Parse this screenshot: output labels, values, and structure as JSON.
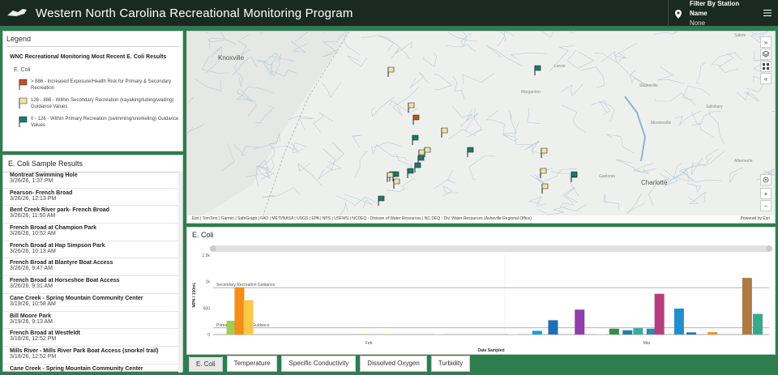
{
  "header": {
    "title": "Western North Carolina Recreational Monitoring Program",
    "filter_title": "Filter By Station Name",
    "filter_value": "None"
  },
  "legend": {
    "heading": "Legend",
    "title": "WNC Recreational Monitoring Most Recent E. Coli Results",
    "layer": "E. Coli",
    "items": [
      {
        "label": "> 886 - Increased Exposure/Health Risk for Primary & Secondary Recreation",
        "color": "#c0521f"
      },
      {
        "label": "126 - 886 - Within Secondary Recreation (kayaking/tubing/wading) Guidance Values",
        "color": "#ece3a6"
      },
      {
        "label": "0 - 126 - Within Primary Recreation (swimming/snorkeling) Guidance Values",
        "color": "#1d7a6a"
      }
    ]
  },
  "list": {
    "heading": "E. Coli Sample Results",
    "items": [
      {
        "name": "Montreat Swimming Hole",
        "date": "3/26/26, 1:37 PM"
      },
      {
        "name": "Pearson- French Broad",
        "date": "3/26/26, 12:13 PM"
      },
      {
        "name": "Bent Creek River park- French Broad",
        "date": "3/26/26, 11:50 AM"
      },
      {
        "name": "French Broad at Champion Park",
        "date": "3/26/26, 10:52 AM"
      },
      {
        "name": "French Broad at Hap Simpson Park",
        "date": "3/26/26, 10:13 AM"
      },
      {
        "name": "French Broad at Blantyre Boat Access",
        "date": "3/26/26, 9:47 AM"
      },
      {
        "name": "French Broad at Horseshoe Boat Access",
        "date": "3/26/26, 9:31 AM"
      },
      {
        "name": "Cane Creek - Spring Mountain Community Center",
        "date": "3/19/26, 10:58 AM"
      },
      {
        "name": "Bill Moore Park",
        "date": "3/19/26, 9:13 AM"
      },
      {
        "name": "French Broad at Westfeldt",
        "date": "3/18/26, 12:52 PM"
      },
      {
        "name": "Mills River - Mills River Park Boat Access (snorkel trail)",
        "date": "3/18/26, 12:52 PM"
      },
      {
        "name": "Cane Creek - Spring Mountain Community Center",
        "date": ""
      }
    ]
  },
  "map": {
    "cities": [
      "Knoxville",
      "Charlotte"
    ],
    "minor": [
      "Morganton",
      "Statesville",
      "Salisbury",
      "Mooresville",
      "Lenoir",
      "Gastonia",
      "Albemarle",
      "Salem"
    ],
    "attribution": "Esri | TomTom | Garmin | SafeGraph | FAO | METI/NASA | USGS | EPA | NPS | USFWS | NCDEQ - Division of Water Resources | NC DEQ - Div. Water Resources (Asheville Regional Office)",
    "powered": "Powered by Esri",
    "tools": {
      "expand": "»",
      "collapse": "«",
      "zoom_in": "+",
      "zoom_out": "−"
    }
  },
  "chart_title": "E. Coli",
  "chart_data": {
    "type": "bar",
    "ylabel": "MPN / 100mL",
    "xlabel": "Date Sampled",
    "yticks": [
      "0",
      "500",
      "1k",
      "1.5k"
    ],
    "ylim": [
      0,
      1500
    ],
    "xticks": [
      "Feb",
      "Mar"
    ],
    "reference_lines": [
      {
        "label": "Secondary Recreation Guidance",
        "value": 886
      },
      {
        "label": "Primary Recreation Guidance",
        "value": 126
      }
    ],
    "bars": [
      {
        "pos": 0.01,
        "value": 260,
        "color": "#a7c957"
      },
      {
        "pos": 0.025,
        "value": 890,
        "color": "#f28e1c"
      },
      {
        "pos": 0.042,
        "value": 650,
        "color": "#f7c948"
      },
      {
        "pos": 0.255,
        "value": 10,
        "color": "#a7c957"
      },
      {
        "pos": 0.3,
        "value": 8,
        "color": "#a7c957"
      },
      {
        "pos": 0.4,
        "value": 5,
        "color": "#d0d0d0"
      },
      {
        "pos": 0.54,
        "value": 8,
        "color": "#d8d8d8"
      },
      {
        "pos": 0.585,
        "value": 70,
        "color": "#1f9bd6"
      },
      {
        "pos": 0.615,
        "value": 270,
        "color": "#1f6fb4"
      },
      {
        "pos": 0.665,
        "value": 470,
        "color": "#8f3fa7"
      },
      {
        "pos": 0.705,
        "value": 10,
        "color": "#d8d8d8"
      },
      {
        "pos": 0.73,
        "value": 110,
        "color": "#3a8a4b"
      },
      {
        "pos": 0.755,
        "value": 80,
        "color": "#1d7fa8"
      },
      {
        "pos": 0.775,
        "value": 120,
        "color": "#3da9a0"
      },
      {
        "pos": 0.8,
        "value": 110,
        "color": "#2e8bb0"
      },
      {
        "pos": 0.815,
        "value": 770,
        "color": "#b53f7e"
      },
      {
        "pos": 0.852,
        "value": 490,
        "color": "#1f8fce"
      },
      {
        "pos": 0.875,
        "value": 40,
        "color": "#1f6fb4"
      },
      {
        "pos": 0.915,
        "value": 45,
        "color": "#f2931c"
      },
      {
        "pos": 0.98,
        "value": 1070,
        "color": "#b07a45"
      },
      {
        "pos": 1.0,
        "value": 390,
        "color": "#3aa88a"
      }
    ]
  },
  "tabs": [
    "E. Coli",
    "Temperature",
    "Specific Conductivity",
    "Dissolved Oxygen",
    "Turbidity"
  ]
}
